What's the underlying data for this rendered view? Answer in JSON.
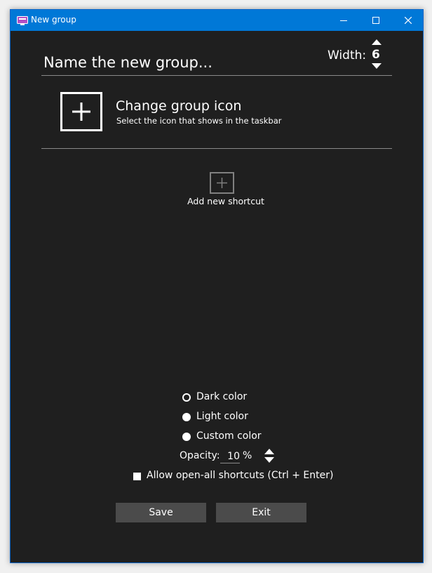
{
  "window": {
    "title": "New group",
    "accent_color": "#0078d7",
    "background_color": "#1f1f1f"
  },
  "title_bar_buttons": {
    "minimize_icon": "minimize-icon",
    "maximize_icon": "maximize-icon",
    "close_icon": "close-icon"
  },
  "group_name": {
    "placeholder": "Name the new group...",
    "value": ""
  },
  "width": {
    "label": "Width:",
    "value": "6"
  },
  "group_icon": {
    "icon": "plus-icon",
    "title": "Change group icon",
    "subtitle": "Select the icon that shows in the taskbar"
  },
  "shortcuts": {
    "add_icon": "plus-icon",
    "add_label": "Add new shortcut"
  },
  "color_options": [
    {
      "label": "Dark color",
      "selected": true
    },
    {
      "label": "Light color",
      "selected": false
    },
    {
      "label": "Custom color",
      "selected": false
    }
  ],
  "opacity": {
    "label": "Opacity:",
    "value": "10",
    "unit": "%"
  },
  "allow_open_all": {
    "label": "Allow open-all shortcuts (Ctrl + Enter)",
    "checked": false
  },
  "actions": {
    "save_label": "Save",
    "exit_label": "Exit"
  }
}
